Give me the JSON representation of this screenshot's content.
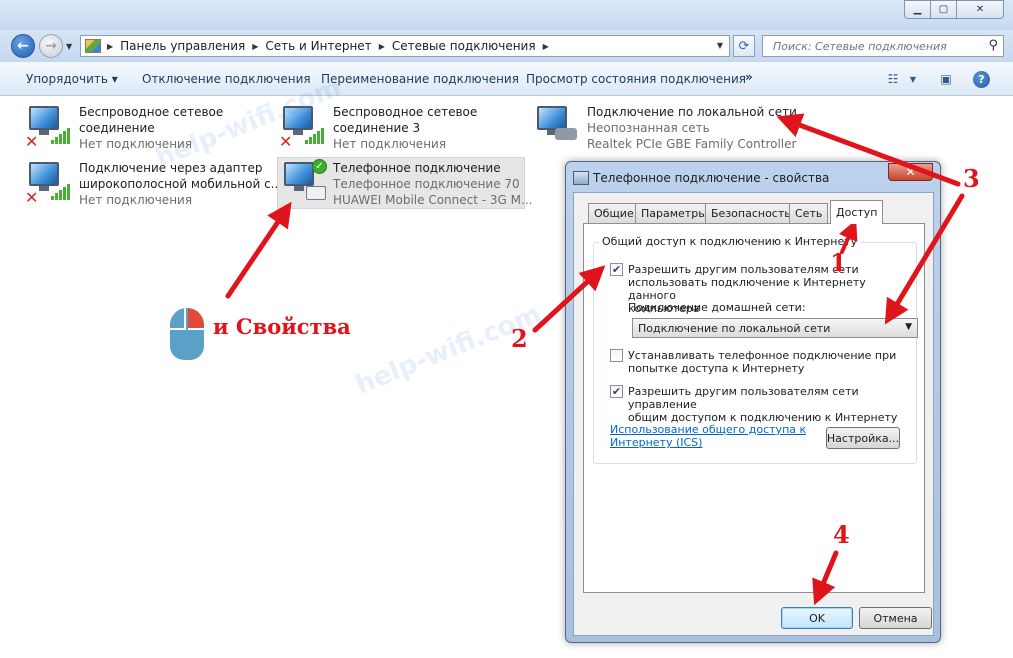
{
  "window": {
    "minimize_glyph": "▁",
    "maximize_glyph": "▢",
    "close_glyph": "✕"
  },
  "navigation": {
    "breadcrumbs": [
      "Панель управления",
      "Сеть и Интернет",
      "Сетевые подключения"
    ],
    "search_placeholder": "Поиск: Сетевые подключения"
  },
  "toolbar": {
    "organize": "Упорядочить ▾",
    "disable": "Отключение подключения",
    "rename": "Переименование подключения",
    "view_status": "Просмотр состояния подключения",
    "more": "»"
  },
  "connections": [
    {
      "name1": "Беспроводное сетевое",
      "name2": "соединение",
      "status": "Нет подключения",
      "state": "disconnected",
      "icon": "wireless-network-icon"
    },
    {
      "name1": "Беспроводное сетевое",
      "name2": "соединение 3",
      "status": "Нет подключения",
      "state": "disconnected",
      "icon": "wireless-network-icon"
    },
    {
      "name1": "Подключение по локальной сети",
      "name2": "Неопознанная сеть",
      "status": "Realtek PCIe GBE Family Controller",
      "state": "connected",
      "icon": "lan-network-icon"
    },
    {
      "name1": "Подключение через адаптер",
      "name2": "широкополосной мобильной с...",
      "status": "Нет подключения",
      "state": "disconnected",
      "icon": "mobile-broadband-icon"
    },
    {
      "name1": "Телефонное подключение",
      "name2": "Телефонное подключение  70",
      "status": "HUAWEI Mobile Connect - 3G M...",
      "state": "selected",
      "icon": "dialup-connection-icon"
    }
  ],
  "dialog": {
    "title": "Телефонное подключение - свойства",
    "close_glyph": "✕",
    "tabs": [
      "Общие",
      "Параметры",
      "Безопасность",
      "Сеть",
      "Доступ"
    ],
    "active_tab": "Доступ",
    "group_title": "Общий доступ к подключению к Интернету",
    "allow_sharing": {
      "checked": true,
      "line1": "Разрешить другим пользователям сети",
      "line2": "использовать подключение к Интернету данного",
      "line3": "компьютера"
    },
    "home_network_label": "Подключение домашней сети:",
    "home_network_value": "Подключение по локальной сети",
    "dial_on_demand": {
      "checked": false,
      "line1": "Устанавливать телефонное подключение при",
      "line2": "попытке доступа к Интернету"
    },
    "allow_control": {
      "checked": true,
      "line1": "Разрешить другим пользователям сети управление",
      "line2": "общим доступом к подключению к Интернету"
    },
    "ics_link_line1": "Использование общего доступа к",
    "ics_link_line2": "Интернету (ICS)",
    "settings_button": "Настройка...",
    "ok_button": "OK",
    "cancel_button": "Отмена"
  },
  "annotations": {
    "step1": "1",
    "step2": "2",
    "step3": "3",
    "step4": "4",
    "mouse_caption": "и Свойства",
    "color": "#e0141b"
  },
  "watermark": "help-wifi.com"
}
